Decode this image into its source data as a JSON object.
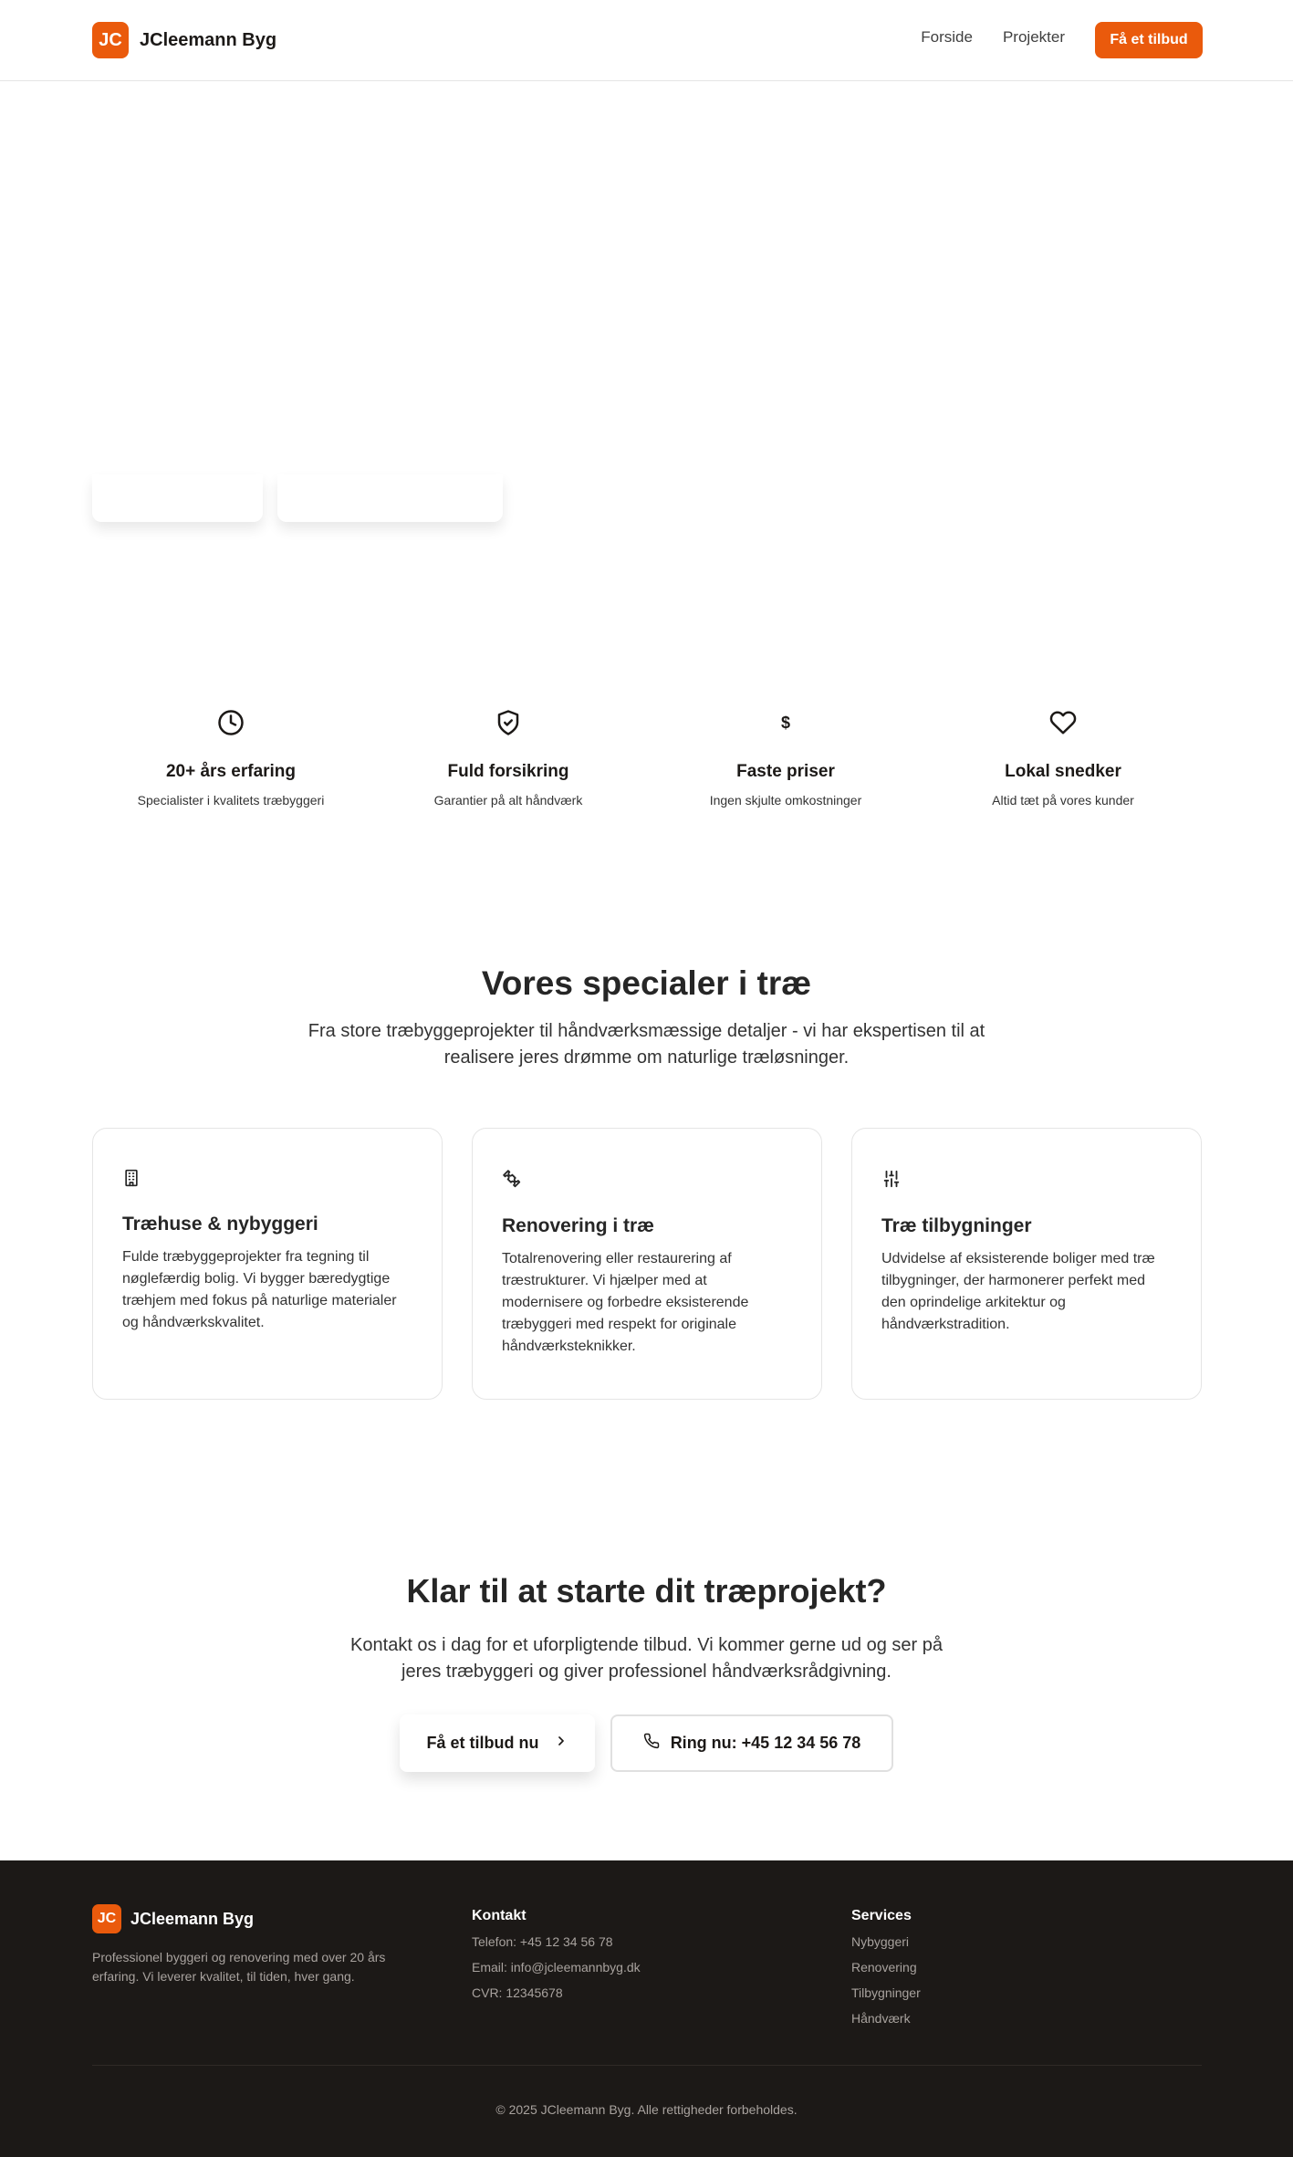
{
  "header": {
    "logo_badge": "JC",
    "brand": "JCleemann Byg",
    "nav": [
      "Forside",
      "Projekter"
    ],
    "cta": "Få et tilbud"
  },
  "features": [
    {
      "icon": "clock-icon",
      "title": "20+ års erfaring",
      "desc": "Specialister i kvalitets træbyggeri"
    },
    {
      "icon": "shield-check-icon",
      "title": "Fuld forsikring",
      "desc": "Garantier på alt håndværk"
    },
    {
      "icon": "dollar-icon",
      "title": "Faste priser",
      "desc": "Ingen skjulte omkostninger"
    },
    {
      "icon": "heart-icon",
      "title": "Lokal snedker",
      "desc": "Altid tæt på vores kunder"
    }
  ],
  "specials": {
    "title": "Vores specialer i træ",
    "subtitle": "Fra store træbyggeprojekter til håndværksmæssige detaljer - vi har ekspertisen til at realisere jeres drømme om naturlige træløsninger.",
    "cards": [
      {
        "icon": "building-icon",
        "title": "Træhuse & nybyggeri",
        "desc": "Fulde træbyggeprojekter fra tegning til nøglefærdig bolig. Vi bygger bæredygtige træhjem med fokus på naturlige materialer og håndværkskvalitet."
      },
      {
        "icon": "puzzle-icon",
        "title": "Renovering i træ",
        "desc": "Totalrenovering eller restaurering af træstrukturer. Vi hjælper med at modernisere og forbedre eksisterende træbyggeri med respekt for originale håndværksteknikker."
      },
      {
        "icon": "sliders-icon",
        "title": "Træ tilbygninger",
        "desc": "Udvidelse af eksisterende boliger med træ tilbygninger, der harmonerer perfekt med den oprindelige arkitektur og håndværkstradition."
      }
    ]
  },
  "cta": {
    "title": "Klar til at starte dit træprojekt?",
    "subtitle": "Kontakt os i dag for et uforpligtende tilbud. Vi kommer gerne ud og ser på jeres træbyggeri og giver professionel håndværksrådgivning.",
    "primary": "Få et tilbud nu",
    "secondary": "Ring nu: +45 12 34 56 78"
  },
  "footer": {
    "logo_badge": "JC",
    "brand": "JCleemann Byg",
    "desc": "Professionel byggeri og renovering med over 20 års erfaring. Vi leverer kvalitet, til tiden, hver gang.",
    "contact_heading": "Kontakt",
    "contact": [
      "Telefon: +45 12 34 56 78",
      "Email: info@jcleemannbyg.dk",
      "CVR: 12345678"
    ],
    "services_heading": "Services",
    "services": [
      "Nybyggeri",
      "Renovering",
      "Tilbygninger",
      "Håndværk"
    ],
    "copyright": "© 2025 JCleemann Byg. Alle rettigheder forbeholdes."
  },
  "colors": {
    "accent": "#ea5a0c",
    "footer_bg": "#1c1917"
  }
}
